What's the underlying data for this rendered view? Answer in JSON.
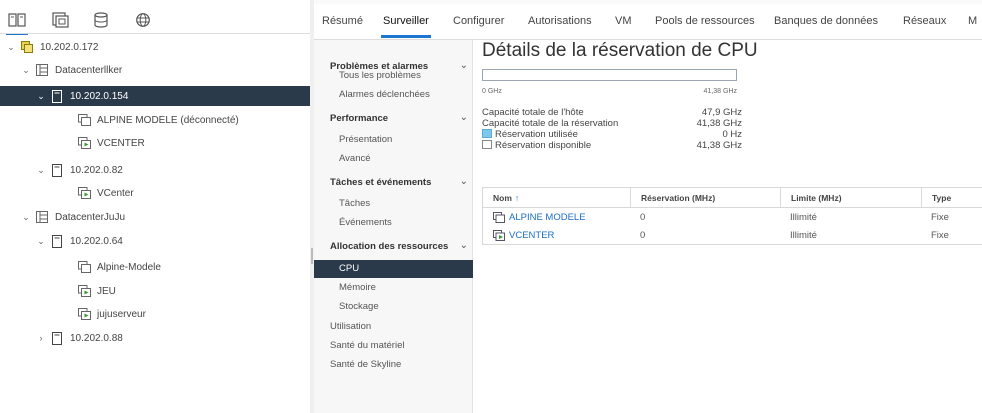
{
  "colors": {
    "accent": "#1b76d2",
    "selected_bg": "#2b3a4a",
    "used_swatch": "#7ec8ec",
    "link": "#1b6ec2"
  },
  "inventory_tabs": [
    {
      "icon": "hosts-clusters-icon"
    },
    {
      "icon": "vms-templates-icon"
    },
    {
      "icon": "storage-icon"
    },
    {
      "icon": "networking-icon"
    }
  ],
  "tree": [
    {
      "label": "10.202.0.172",
      "icon": "vcenter-icon",
      "chevron": "⌄"
    },
    {
      "label": "Datacenterllker",
      "icon": "datacenter-icon",
      "chevron": "⌄"
    },
    {
      "label": "10.202.0.154",
      "icon": "host-icon",
      "chevron": "⌄"
    },
    {
      "label": "ALPINE MODELE (déconnecté)",
      "icon": "vm-icon",
      "chevron": ""
    },
    {
      "label": "VCENTER",
      "icon": "vm-on-icon",
      "chevron": ""
    },
    {
      "label": "10.202.0.82",
      "icon": "host-icon",
      "chevron": "⌄"
    },
    {
      "label": "VCenter",
      "icon": "vm-on-icon",
      "chevron": ""
    },
    {
      "label": "DatacenterJuJu",
      "icon": "datacenter-icon",
      "chevron": "⌄"
    },
    {
      "label": "10.202.0.64",
      "icon": "host-icon",
      "chevron": "⌄"
    },
    {
      "label": "Alpine-Modele",
      "icon": "vm-icon",
      "chevron": ""
    },
    {
      "label": "JEU",
      "icon": "vm-on-icon",
      "chevron": ""
    },
    {
      "label": "jujuserveur",
      "icon": "vm-on-icon",
      "chevron": ""
    },
    {
      "label": "10.202.0.88",
      "icon": "host-icon",
      "chevron": "›"
    }
  ],
  "tabs": [
    "Résumé",
    "Surveiller",
    "Configurer",
    "Autorisations",
    "VM",
    "Pools de ressources",
    "Banques de données",
    "Réseaux",
    "M"
  ],
  "subnav": {
    "sections": [
      {
        "title": "Problèmes et alarmes",
        "items": [
          "Tous les problèmes",
          "Alarmes déclenchées"
        ]
      },
      {
        "title": "Performance",
        "items": [
          "Présentation",
          "Avancé"
        ]
      },
      {
        "title": "Tâches et événements",
        "items": [
          "Tâches",
          "Événements"
        ]
      },
      {
        "title": "Allocation des ressources",
        "items": [
          "CPU",
          "Mémoire",
          "Stockage"
        ]
      }
    ],
    "top_items": [
      "Utilisation",
      "Santé du matériel",
      "Santé de Skyline"
    ]
  },
  "main": {
    "title": "Détails de la réservation de CPU",
    "axis_min": "0 GHz",
    "axis_max": "41,38 GHz",
    "used_fraction": 0,
    "stats": [
      {
        "label": "Capacité totale de l'hôte",
        "value": "47,9 GHz"
      },
      {
        "label": "Capacité totale de la réservation",
        "value": "41,38 GHz"
      },
      {
        "label": "Réservation utilisée",
        "value": "0 Hz",
        "swatch": "used"
      },
      {
        "label": "Réservation disponible",
        "value": "41,38 GHz",
        "swatch": "available"
      }
    ],
    "grid": {
      "headers": [
        "Nom",
        "Réservation (MHz)",
        "Limite (MHz)",
        "Type"
      ],
      "rows": [
        {
          "name": "ALPINE MODELE",
          "icon": "vm-icon",
          "reservation": "0",
          "limit": "Illimité",
          "type": "Fixe"
        },
        {
          "name": "VCENTER",
          "icon": "vm-on-icon",
          "reservation": "0",
          "limit": "Illimité",
          "type": "Fixe"
        }
      ]
    }
  }
}
